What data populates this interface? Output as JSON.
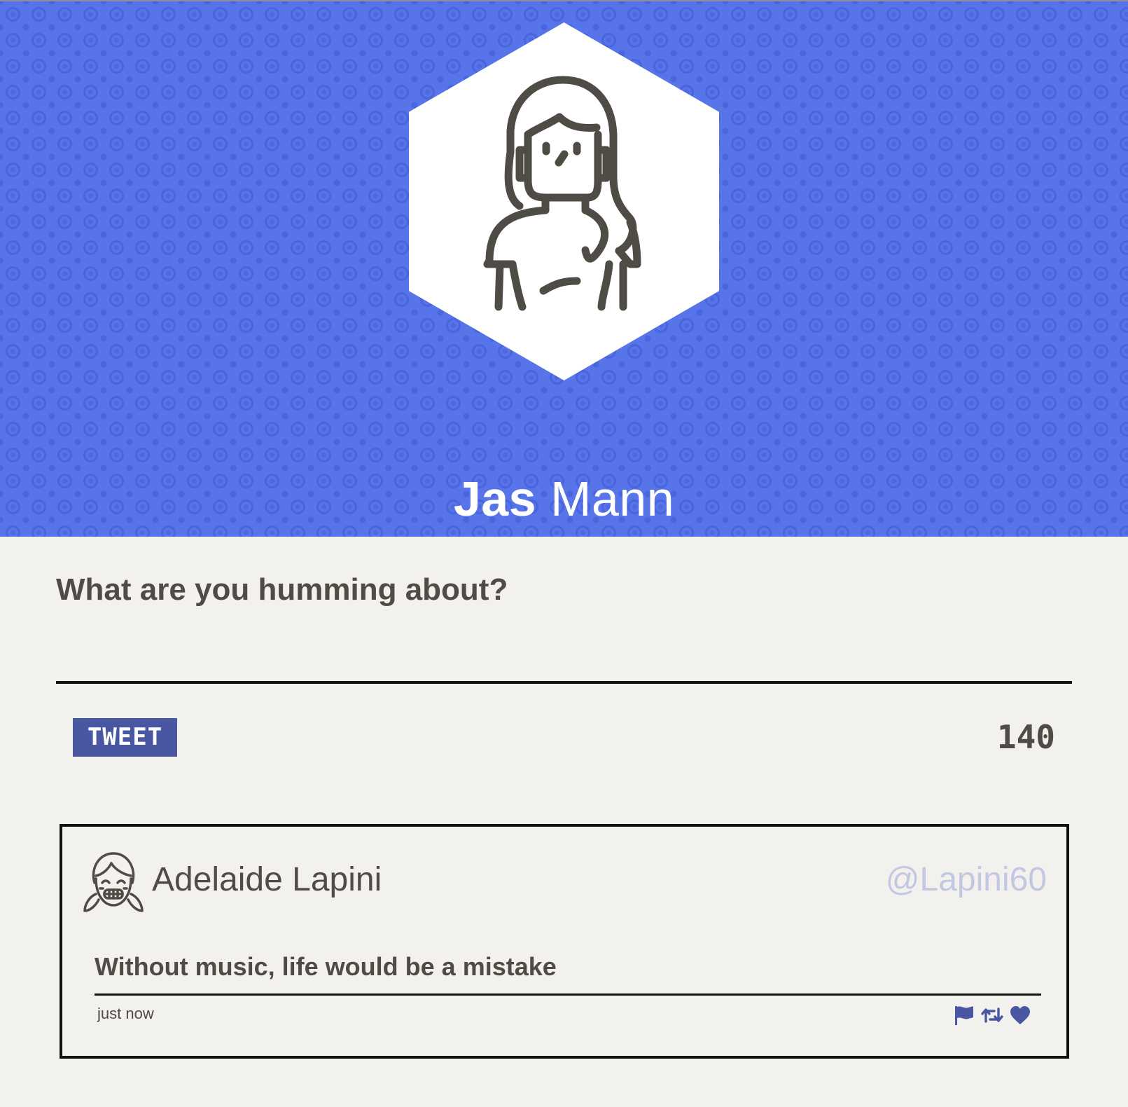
{
  "profile": {
    "first_name": "Jas",
    "last_name": "Mann",
    "avatar_icon": "woman-avatar-icon"
  },
  "compose": {
    "prompt": "What are you humming about?",
    "input_value": "",
    "tweet_button_label": "TWEET",
    "char_count": "140"
  },
  "feed": [
    {
      "author": "Adelaide Lapini",
      "handle": "@Lapini60",
      "avatar_icon": "girl-avatar-icon",
      "text": "Without music, life would be a mistake",
      "timestamp": "just now",
      "actions": [
        "flag-icon",
        "retweet-icon",
        "heart-icon"
      ]
    }
  ],
  "colors": {
    "banner": "#5774e9",
    "accent": "#4957a3",
    "text": "#4f4c45",
    "handle": "#c3c8e2",
    "background": "#f2f1ed"
  }
}
